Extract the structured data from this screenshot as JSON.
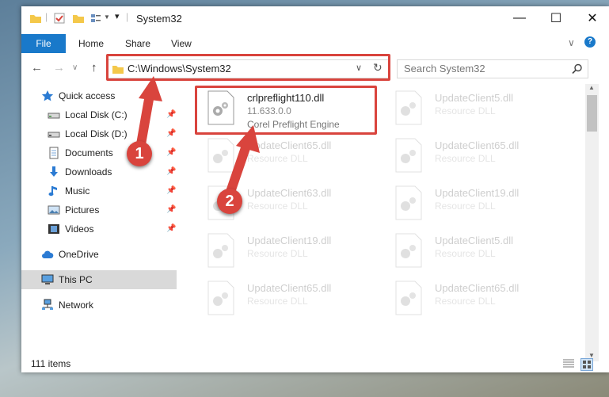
{
  "window": {
    "title": "System32",
    "minimize": "—",
    "maximize": "☐",
    "close": "✕"
  },
  "ribbon": {
    "file": "File",
    "tabs": [
      "Home",
      "Share",
      "View"
    ],
    "help": "?",
    "expand": "∨"
  },
  "nav": {
    "back": "←",
    "forward": "→",
    "recent": "∨",
    "up": "↑",
    "address": "C:\\Windows\\System32",
    "dropdown": "∨",
    "refresh": "↻",
    "search_placeholder": "Search System32"
  },
  "sidebar": {
    "items": [
      {
        "label": "Quick access",
        "icon": "star-icon"
      },
      {
        "label": "Local Disk (C:)",
        "icon": "drive-icon"
      },
      {
        "label": "Local Disk (D:)",
        "icon": "drive-icon"
      },
      {
        "label": "Documents",
        "icon": "documents-icon"
      },
      {
        "label": "Downloads",
        "icon": "download-icon"
      },
      {
        "label": "Music",
        "icon": "music-icon"
      },
      {
        "label": "Pictures",
        "icon": "pictures-icon"
      },
      {
        "label": "Videos",
        "icon": "videos-icon"
      },
      {
        "label": "OneDrive",
        "icon": "cloud-icon"
      },
      {
        "label": "This PC",
        "icon": "computer-icon"
      },
      {
        "label": "Network",
        "icon": "network-icon"
      }
    ]
  },
  "files": [
    {
      "name": "crlpreflight110.dll",
      "line2": "11.633.0.0",
      "line3": "Corel Preflight Engine"
    },
    {
      "name": "UpdateClient5.dll",
      "line2": "Resource DLL"
    },
    {
      "name": "UpdateClient65.dll",
      "line2": "Resource DLL"
    },
    {
      "name": "UpdateClient65.dll",
      "line2": "Resource DLL"
    },
    {
      "name": "UpdateClient63.dll",
      "line2": "Resource DLL"
    },
    {
      "name": "UpdateClient19.dll",
      "line2": "Resource DLL"
    },
    {
      "name": "UpdateClient19.dll",
      "line2": "Resource DLL"
    },
    {
      "name": "UpdateClient5.dll",
      "line2": "Resource DLL"
    },
    {
      "name": "UpdateClient65.dll",
      "line2": "Resource DLL"
    },
    {
      "name": "UpdateClient65.dll",
      "line2": "Resource DLL"
    }
  ],
  "status": {
    "count": "111 items"
  },
  "annotations": {
    "step1": "1",
    "step2": "2"
  },
  "colors": {
    "accent": "#1979ca",
    "highlight": "#d9443d"
  }
}
